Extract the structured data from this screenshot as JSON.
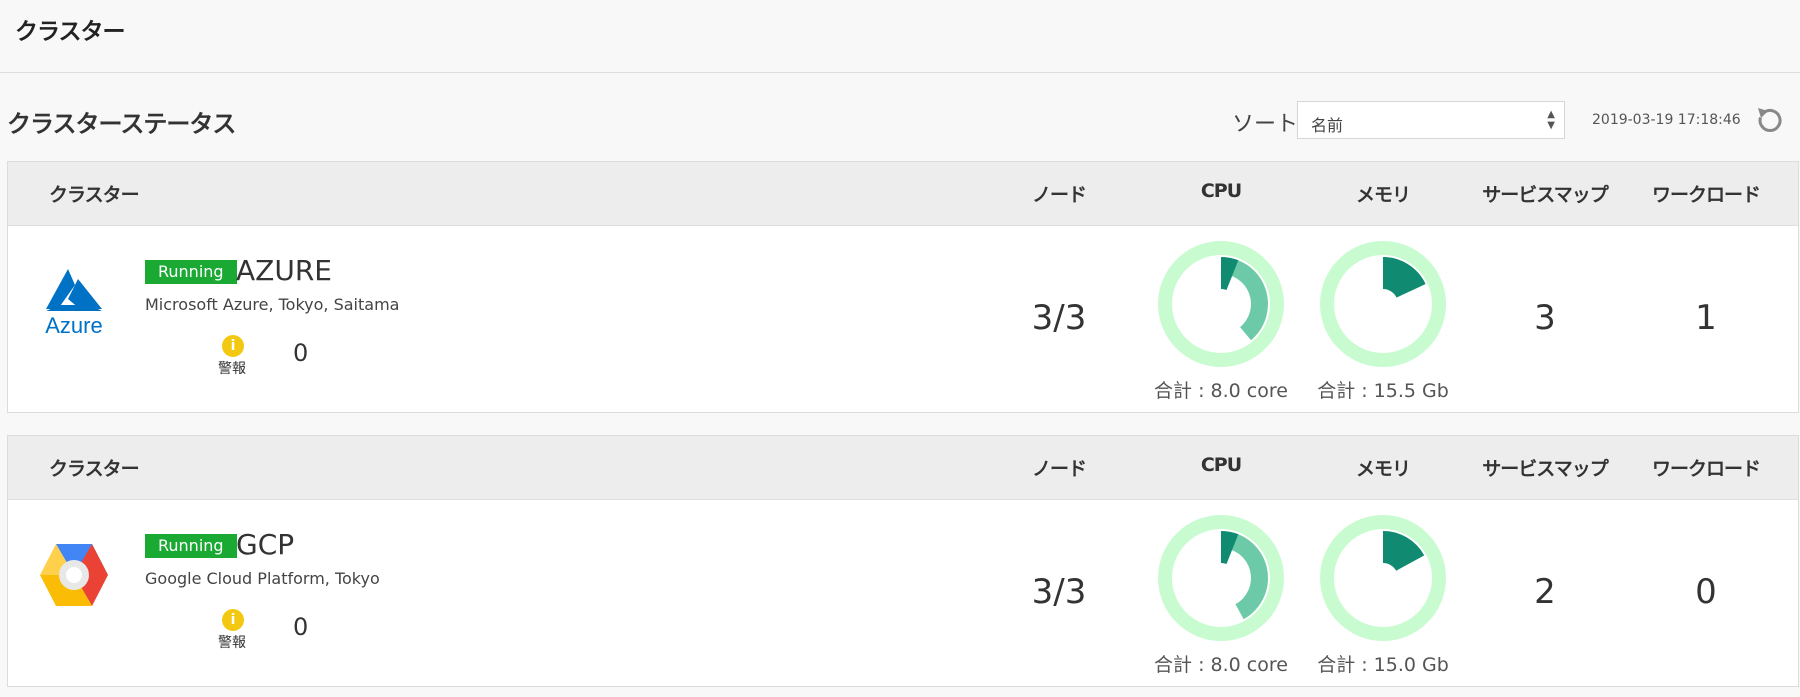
{
  "page": {
    "title": "クラスター"
  },
  "section": {
    "title": "クラスターステータス"
  },
  "sort": {
    "label": "ソート",
    "value": "名前"
  },
  "timestamp": "2019-03-19 17:18:46",
  "columns": {
    "cluster": "クラスター",
    "node": "ノード",
    "cpu": "CPU",
    "memory": "メモリ",
    "servicemap": "サービスマップ",
    "workload": "ワークロード"
  },
  "warning_label": "警報",
  "colors": {
    "running": "#1aaa33",
    "donut_track": "#c8fcd0",
    "donut_usage": "#6dcaa8",
    "donut_request": "#118a72",
    "warning": "#f2c811"
  },
  "clusters": [
    {
      "name": "AZURE",
      "status": "Running",
      "description": "Microsoft Azure, Tokyo, Saitama",
      "logo": "azure-logo",
      "warnings": "0",
      "nodes": "3/3",
      "cpu": {
        "total": "合計 : 8.0 core",
        "usage": 0.39,
        "request": 0.06
      },
      "memory": {
        "total": "合計 : 15.5 Gb",
        "usage": 0.18,
        "request": 0.18
      },
      "servicemaps": "3",
      "workloads": "1"
    },
    {
      "name": "GCP",
      "status": "Running",
      "description": "Google Cloud Platform, Tokyo",
      "logo": "gcp-logo",
      "warnings": "0",
      "nodes": "3/3",
      "cpu": {
        "total": "合計 : 8.0 core",
        "usage": 0.42,
        "request": 0.06
      },
      "memory": {
        "total": "合計 : 15.0 Gb",
        "usage": 0.17,
        "request": 0.17
      },
      "servicemaps": "2",
      "workloads": "0"
    }
  ]
}
